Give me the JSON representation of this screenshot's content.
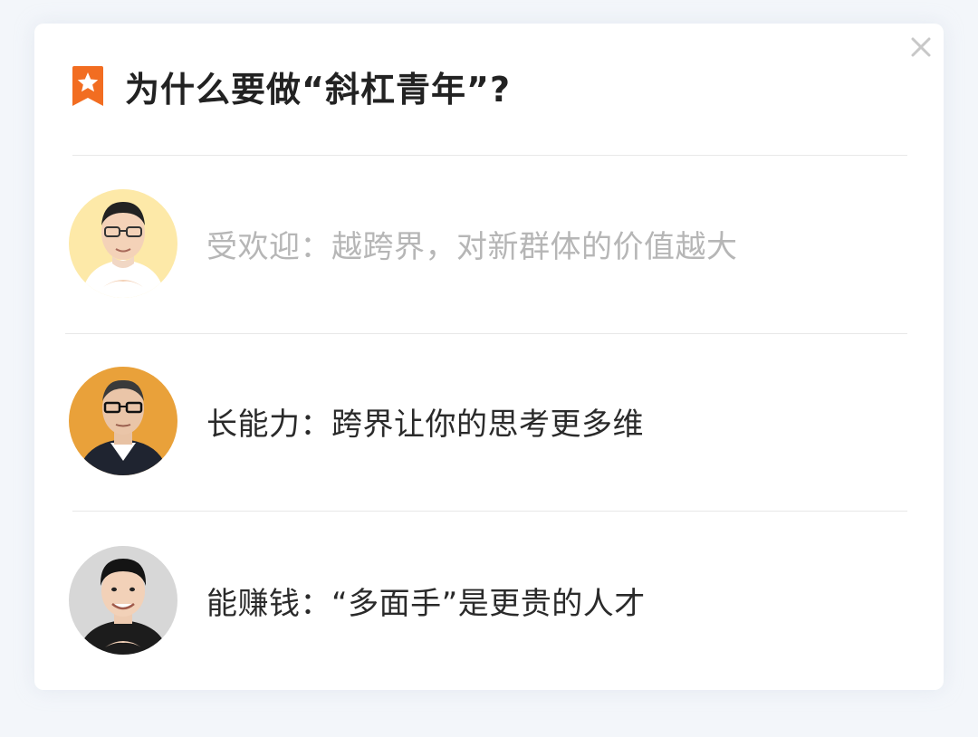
{
  "card": {
    "title": "为什么要做“斜杠青年”?",
    "close_icon": "close-icon",
    "badge_icon": "star-bookmark-icon",
    "accent_color": "#f26d21"
  },
  "reasons": [
    {
      "text": "受欢迎：越跨界，对新群体的价值越大",
      "style": "muted",
      "avatar_bg": "#fde9a8"
    },
    {
      "text": "长能力：跨界让你的思考更多维",
      "style": "normal",
      "avatar_bg": "#e9a13a"
    },
    {
      "text": "能赚钱：“多面手”是更贵的人才",
      "style": "normal",
      "avatar_bg": "#d7d7d7"
    }
  ]
}
